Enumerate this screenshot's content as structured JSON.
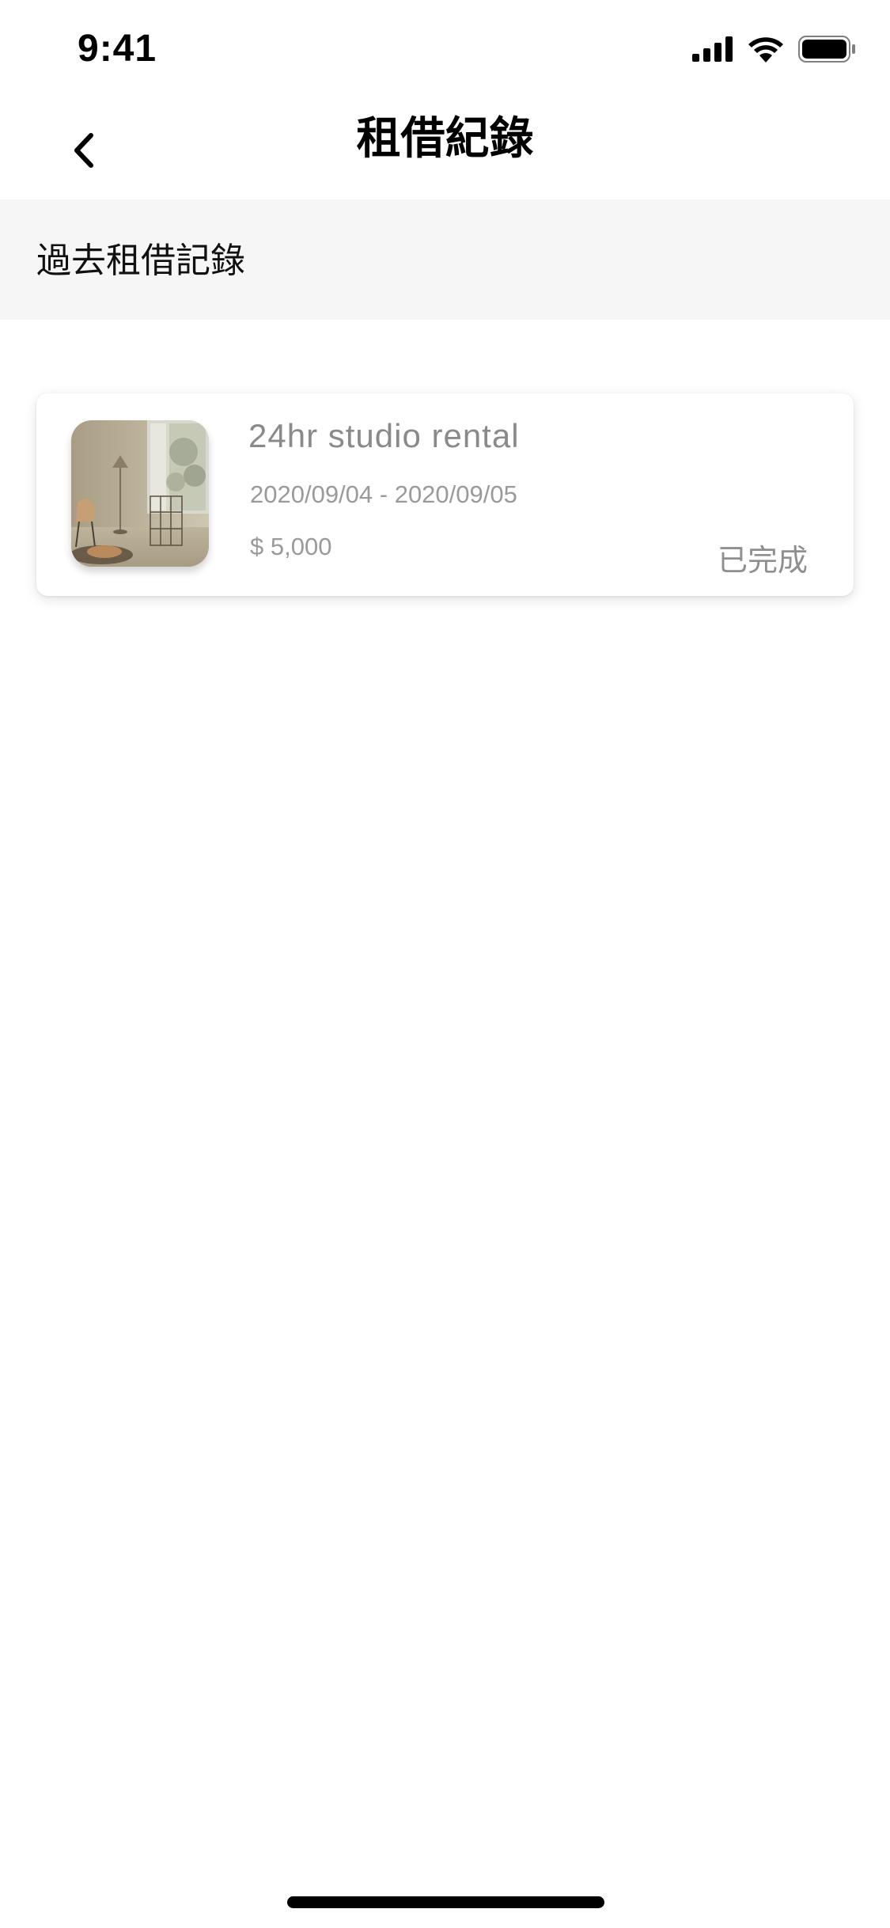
{
  "status_bar": {
    "time": "9:41",
    "icons": [
      "signal-icon",
      "wifi-icon",
      "battery-icon"
    ]
  },
  "nav": {
    "title": "租借紀錄",
    "back_icon": "chevron-left-icon"
  },
  "section": {
    "label": "過去租借記錄"
  },
  "rentals": [
    {
      "title": "24hr studio rental",
      "dates": "2020/09/04 - 2020/09/05",
      "price": "$ 5,000",
      "status": "已完成",
      "image": "studio-photo"
    }
  ],
  "colors": {
    "section_bg": "#f6f6f6",
    "muted_text": "#8a8a8a",
    "home_indicator": "#000000"
  }
}
